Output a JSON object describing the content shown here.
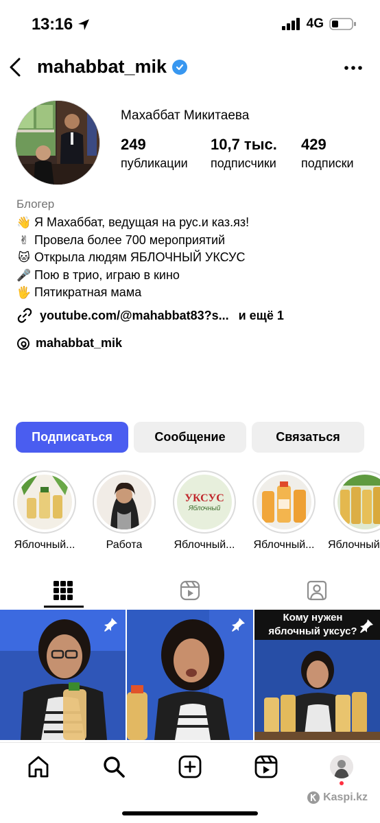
{
  "status_bar": {
    "time": "13:16",
    "network": "4G"
  },
  "header": {
    "username": "mahabbat_mik",
    "verified_icon": "verified-badge-icon",
    "more_icon": "more-icon"
  },
  "profile": {
    "full_name": "Махаббат Микитаева",
    "stats": [
      {
        "value": "249",
        "label": "публикации"
      },
      {
        "value": "10,7 тыс.",
        "label": "подписчики"
      },
      {
        "value": "429",
        "label": "подписки"
      }
    ],
    "category": "Блогер",
    "bio": [
      {
        "emoji": "👋",
        "text": "Я Махаббат, ведущая на рус.и каз.яз!"
      },
      {
        "emoji": "✌",
        "text": "Провела более 700 мероприятий"
      },
      {
        "emoji": "🐱",
        "text": "Открыла людям ЯБЛОЧНЫЙ УКСУС"
      },
      {
        "emoji": "🎤",
        "text": "Пою в трио, играю в кино"
      },
      {
        "emoji": "🖐",
        "text": "Пятикратная мама"
      }
    ],
    "link_text": "youtube.com/@mahabbat83?s...",
    "link_more": "и ещё 1",
    "threads_handle": "mahabbat_mik"
  },
  "actions": {
    "follow": "Подписаться",
    "message": "Сообщение",
    "contact": "Связаться"
  },
  "highlights": [
    {
      "label": "Яблочный..."
    },
    {
      "label": "Работа"
    },
    {
      "label": "Яблочный..."
    },
    {
      "label": "Яблочный..."
    },
    {
      "label": "Яблочный..."
    }
  ],
  "highlight_badge_text": "УКСУС",
  "highlight_badge_sub": "Яблочный",
  "posts": [
    {
      "pinned": true,
      "caption": ""
    },
    {
      "pinned": true,
      "caption": ""
    },
    {
      "pinned": true,
      "caption": "Кому нужен яблочный уксус?"
    }
  ],
  "watermark": "Kaspi.kz",
  "colors": {
    "accent": "#4a5df0",
    "verified": "#3897f0",
    "secondary_button": "#efefef"
  }
}
